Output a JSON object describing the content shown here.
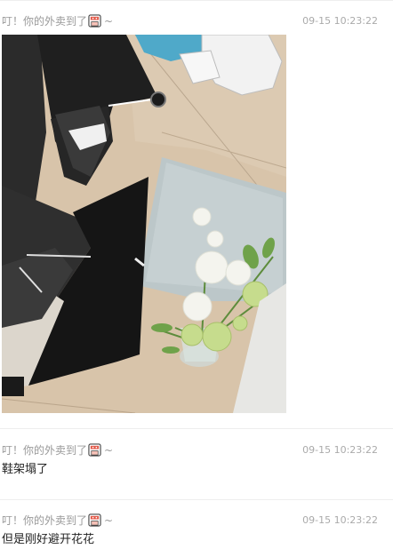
{
  "comments": [
    {
      "author": "叮！你的外卖到了",
      "emoji_icon": "takeout-box-icon",
      "tilde": "~",
      "time": "09-15 10:23:22",
      "text": "",
      "photo_icon": "photo-shoe-rack-flowers"
    },
    {
      "author": "叮！你的外卖到了",
      "emoji_icon": "takeout-box-icon",
      "tilde": "~",
      "time": "09-15 10:23:22",
      "text": "鞋架塌了"
    },
    {
      "author": "叮！你的外卖到了",
      "emoji_icon": "takeout-box-icon",
      "tilde": "~",
      "time": "09-15 10:23:22",
      "text": "但是刚好避开花花"
    }
  ]
}
